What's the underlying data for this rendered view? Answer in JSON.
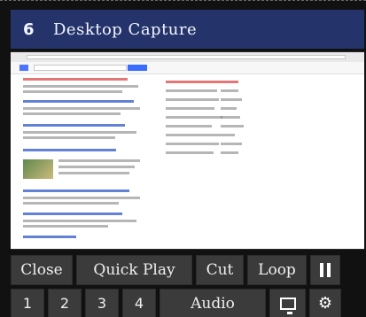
{
  "source": {
    "number": "6",
    "title": "Desktop Capture"
  },
  "controls": {
    "row1": {
      "close": "Close",
      "quick_play": "Quick Play",
      "cut": "Cut",
      "loop": "Loop"
    },
    "row2": {
      "b1": "1",
      "b2": "2",
      "b3": "3",
      "b4": "4",
      "audio": "Audio"
    }
  },
  "icons": {
    "pause": "pause-icon",
    "monitor": "monitor-icon",
    "settings": "gear-icon"
  }
}
